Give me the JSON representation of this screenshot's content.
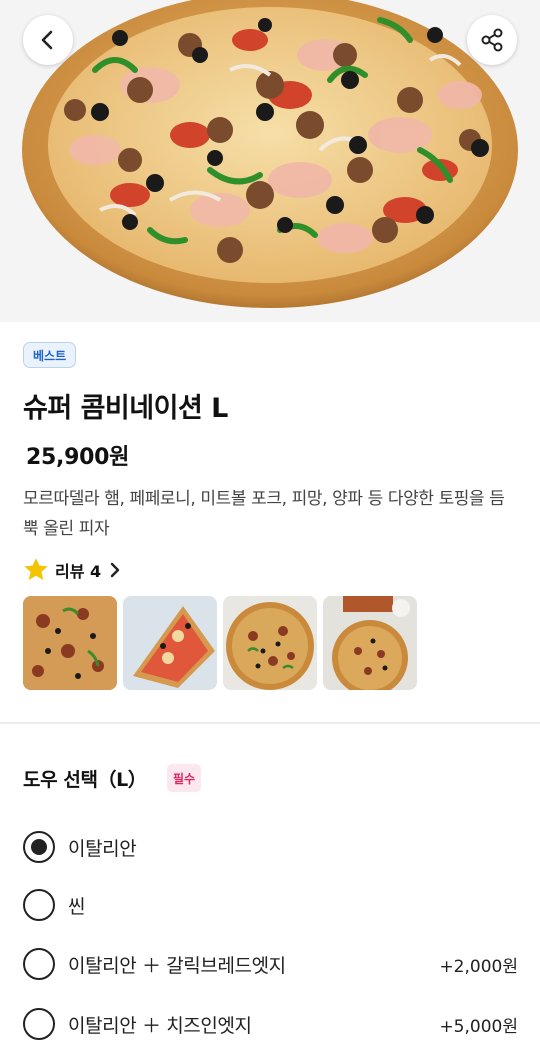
{
  "product": {
    "badge": "베스트",
    "name": "슈퍼 콤비네이션 L",
    "price": "25,900원",
    "description": "모르따델라 햄, 페페로니, 미트볼 포크, 피망, 양파 등 다양한 토핑을 듬뿍 올린 피자"
  },
  "review": {
    "label": "리뷰 4",
    "icon": "star-icon",
    "star_color": "#f5c400"
  },
  "toolbar": {
    "back_icon": "chevron-left-icon",
    "share_icon": "share-icon"
  },
  "dough": {
    "title": "도우 선택（L）",
    "required_label": "필수",
    "options": [
      {
        "label": "이탈리안",
        "price": "",
        "selected": true
      },
      {
        "label": "씬",
        "price": "",
        "selected": false
      },
      {
        "label": "이탈리안 ＋ 갈릭브레드엣지",
        "price": "+2,000원",
        "selected": false
      },
      {
        "label": "이탈리안 ＋ 치즈인엣지",
        "price": "+5,000원",
        "selected": false
      }
    ]
  },
  "colors": {
    "badge_text": "#1f63c9",
    "required_text": "#e0245e",
    "crust": "#c98a3c"
  }
}
